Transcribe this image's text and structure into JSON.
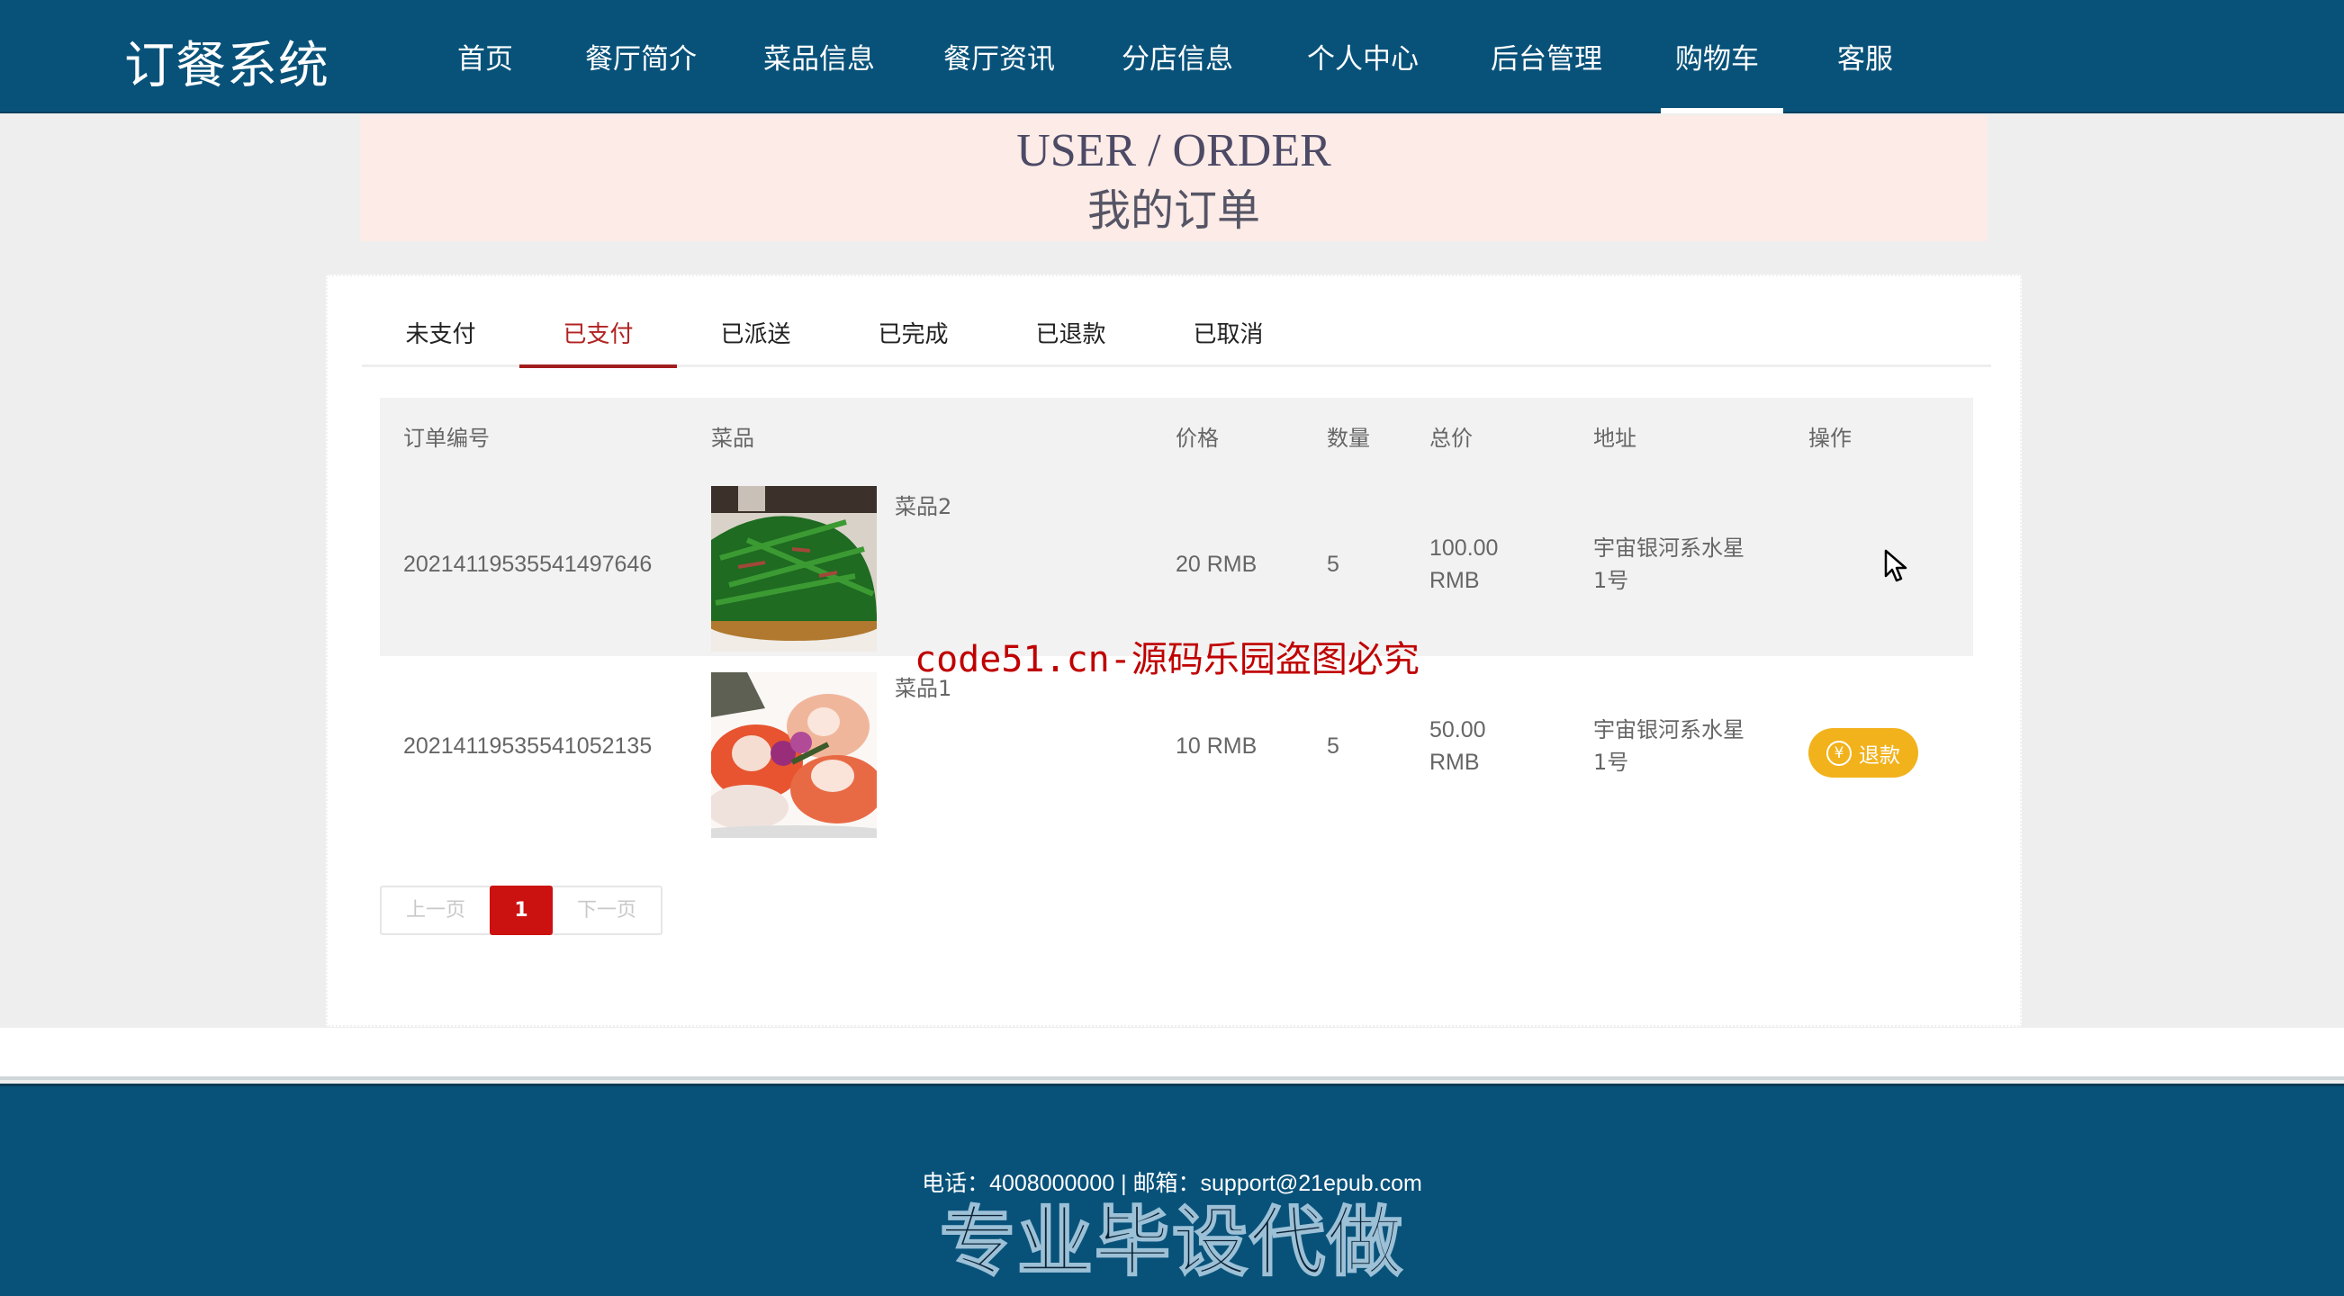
{
  "header": {
    "logo": "订餐系统",
    "nav": [
      {
        "label": "首页",
        "active": false
      },
      {
        "label": "餐厅简介",
        "active": false
      },
      {
        "label": "菜品信息",
        "active": false
      },
      {
        "label": "餐厅资讯",
        "active": false
      },
      {
        "label": "分店信息",
        "active": false
      },
      {
        "label": "个人中心",
        "active": false
      },
      {
        "label": "后台管理",
        "active": false
      },
      {
        "label": "购物车",
        "active": true
      },
      {
        "label": "客服",
        "active": false
      }
    ]
  },
  "banner": {
    "title_en": "USER / ORDER",
    "title_cn": "我的订单"
  },
  "tabs": [
    {
      "label": "未支付",
      "active": false
    },
    {
      "label": "已支付",
      "active": true
    },
    {
      "label": "已派送",
      "active": false
    },
    {
      "label": "已完成",
      "active": false
    },
    {
      "label": "已退款",
      "active": false
    },
    {
      "label": "已取消",
      "active": false
    }
  ],
  "table": {
    "columns": [
      "订单编号",
      "菜品",
      "价格",
      "数量",
      "总价",
      "地址",
      "操作"
    ],
    "rows": [
      {
        "order_no": "20214119535541497646",
        "dish_name": "菜品2",
        "dish_image": "stir-fried-greens",
        "price": "20 RMB",
        "quantity": "5",
        "total_line1": "100.00",
        "total_line2": "RMB",
        "address_line1": "宇宙银河系水星",
        "address_line2": "1号",
        "action": ""
      },
      {
        "order_no": "20214119535541052135",
        "dish_name": "菜品1",
        "dish_image": "scallops",
        "price": "10 RMB",
        "quantity": "5",
        "total_line1": "50.00",
        "total_line2": "RMB",
        "address_line1": "宇宙银河系水星",
        "address_line2": "1号",
        "action": "退款",
        "action_icon": "yen-icon",
        "action_icon_glyph": "¥"
      }
    ]
  },
  "pagination": {
    "prev": "上一页",
    "current": "1",
    "next": "下一页"
  },
  "watermark": "code51.cn-源码乐园盗图必究",
  "footer": {
    "contact": "电话：4008000000 | 邮箱：support@21epub.com",
    "ad": "专业毕设代做"
  },
  "colors": {
    "header_bg": "#08527a",
    "banner_bg": "#fcebe6",
    "active_tab": "#a31c1c",
    "refund_button": "#f2b21b",
    "current_page": "#cc1111",
    "watermark": "#c00000"
  }
}
